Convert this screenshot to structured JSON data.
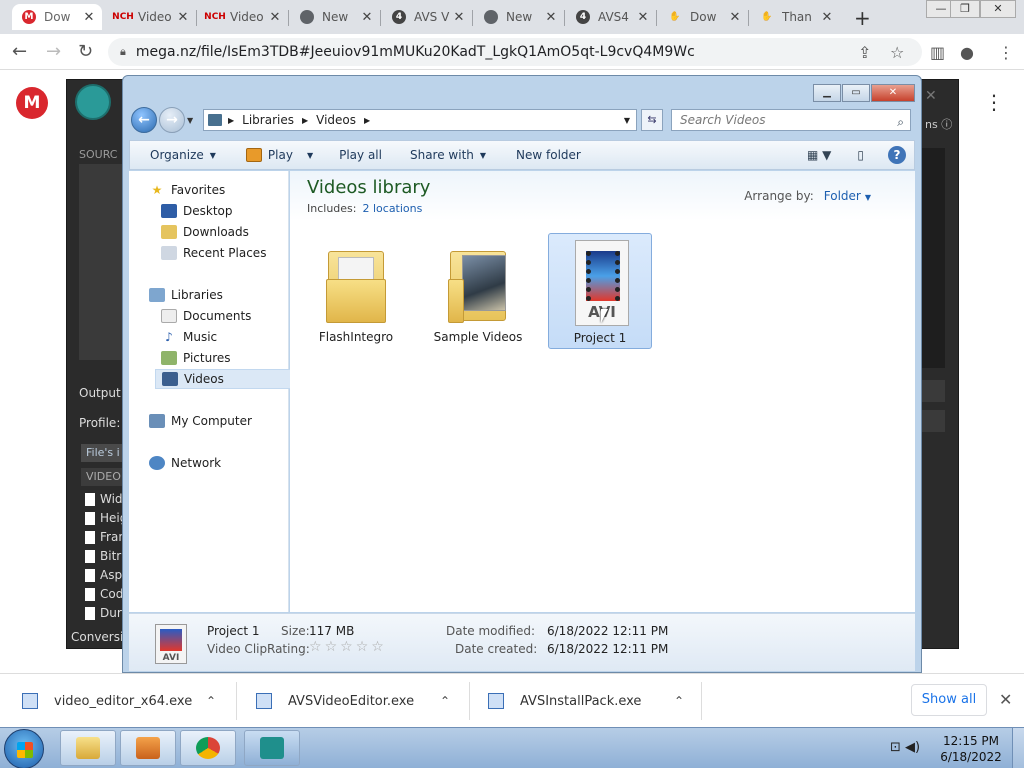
{
  "browser": {
    "tabs": [
      {
        "title": "Dow",
        "icon": "mega-icon",
        "active": true
      },
      {
        "title": "Video",
        "icon": "nch-icon"
      },
      {
        "title": "Video",
        "icon": "nch-icon"
      },
      {
        "title": "New",
        "icon": "chrome-icon"
      },
      {
        "title": "AVS V",
        "icon": "avs-icon"
      },
      {
        "title": "New",
        "icon": "chrome-icon"
      },
      {
        "title": "AVS4",
        "icon": "avs-icon"
      },
      {
        "title": "Dow",
        "icon": "hand-icon"
      },
      {
        "title": "Than",
        "icon": "hand-icon"
      }
    ],
    "url": "mega.nz/file/IsEm3TDB#Jeeuiov91mMUKu20KadT_LgkQ1AmO5qt-L9cvQ4M9Wc"
  },
  "mega": {
    "logo_letter": "M"
  },
  "background_app": {
    "source_label": "SOURC",
    "output_label": "Output fi",
    "profile_label": "Profile:",
    "files_info": "File's i",
    "video_tab": "VIDEO",
    "props": [
      "Wid",
      "Heig",
      "Fran",
      "Bitra",
      "Asp",
      "Cod",
      "Dura"
    ],
    "conversion": "Conversio",
    "side_text": "ns"
  },
  "explorer": {
    "breadcrumb": [
      "Libraries",
      "Videos"
    ],
    "search_placeholder": "Search Videos",
    "commands": {
      "organize": "Organize",
      "play": "Play",
      "play_all": "Play all",
      "share_with": "Share with",
      "new_folder": "New folder"
    },
    "nav": {
      "favorites": "Favorites",
      "desktop": "Desktop",
      "downloads": "Downloads",
      "recent_places": "Recent Places",
      "libraries": "Libraries",
      "documents": "Documents",
      "music": "Music",
      "pictures": "Pictures",
      "videos": "Videos",
      "my_computer": "My Computer",
      "network": "Network"
    },
    "library_title": "Videos library",
    "includes_label": "Includes:",
    "includes_link": "2 locations",
    "arrange_label": "Arrange by:",
    "arrange_value": "Folder",
    "items": [
      {
        "name": "FlashIntegro",
        "type": "folder"
      },
      {
        "name": "Sample Videos",
        "type": "folder-photos"
      },
      {
        "name": "Project 1",
        "type": "avi",
        "selected": true
      }
    ],
    "details": {
      "name": "Project 1",
      "type": "Video Clip",
      "size_label": "Size:",
      "size": "117 MB",
      "rating_label": "Rating:",
      "rating": 0,
      "modified_label": "Date modified:",
      "modified": "6/18/2022 12:11 PM",
      "created_label": "Date created:",
      "created": "6/18/2022 12:11 PM",
      "icon_text": "AVI"
    }
  },
  "downloads": {
    "items": [
      "video_editor_x64.exe",
      "AVSVideoEditor.exe",
      "AVSInstallPack.exe"
    ],
    "show_all": "Show all"
  },
  "taskbar": {
    "time": "12:15 PM",
    "date": "6/18/2022"
  }
}
